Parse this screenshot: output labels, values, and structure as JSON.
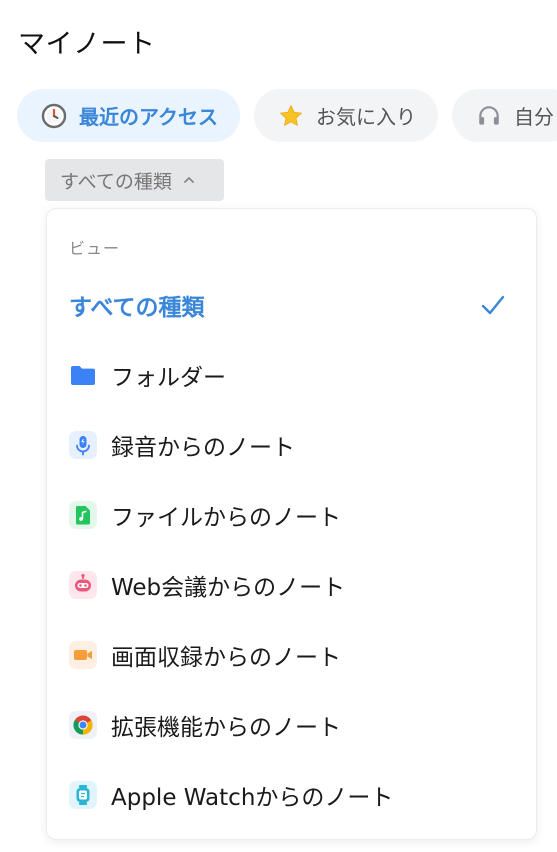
{
  "header": {
    "title": "マイノート"
  },
  "tabs": [
    {
      "label": "最近のアクセス",
      "icon": "clock-icon",
      "active": true
    },
    {
      "label": "お気に入り",
      "icon": "star-icon",
      "active": false
    },
    {
      "label": "自分",
      "icon": "headphones-icon",
      "active": false
    }
  ],
  "filter": {
    "label": "すべての種類",
    "icon": "chevron-up-icon"
  },
  "dropdown": {
    "section_label": "ビュー",
    "items": [
      {
        "label": "すべての種類",
        "selected": true,
        "icon": "check-icon"
      },
      {
        "label": "フォルダー",
        "icon": "folder-icon"
      },
      {
        "label": "録音からのノート",
        "icon": "microphone-icon"
      },
      {
        "label": "ファイルからのノート",
        "icon": "audio-file-icon"
      },
      {
        "label": "Web会議からのノート",
        "icon": "robot-icon"
      },
      {
        "label": "画面収録からのノート",
        "icon": "video-camera-icon"
      },
      {
        "label": "拡張機能からのノート",
        "icon": "chrome-icon"
      },
      {
        "label": "Apple Watchからのノート",
        "icon": "watch-icon"
      }
    ]
  },
  "colors": {
    "accent": "#3a86d8",
    "active_tab_bg": "#eaf4fe",
    "folder": "#3b82f6",
    "file_note": "#22c55e",
    "web_meeting": "#e85a7a",
    "screen_record": "#f59e3b"
  }
}
